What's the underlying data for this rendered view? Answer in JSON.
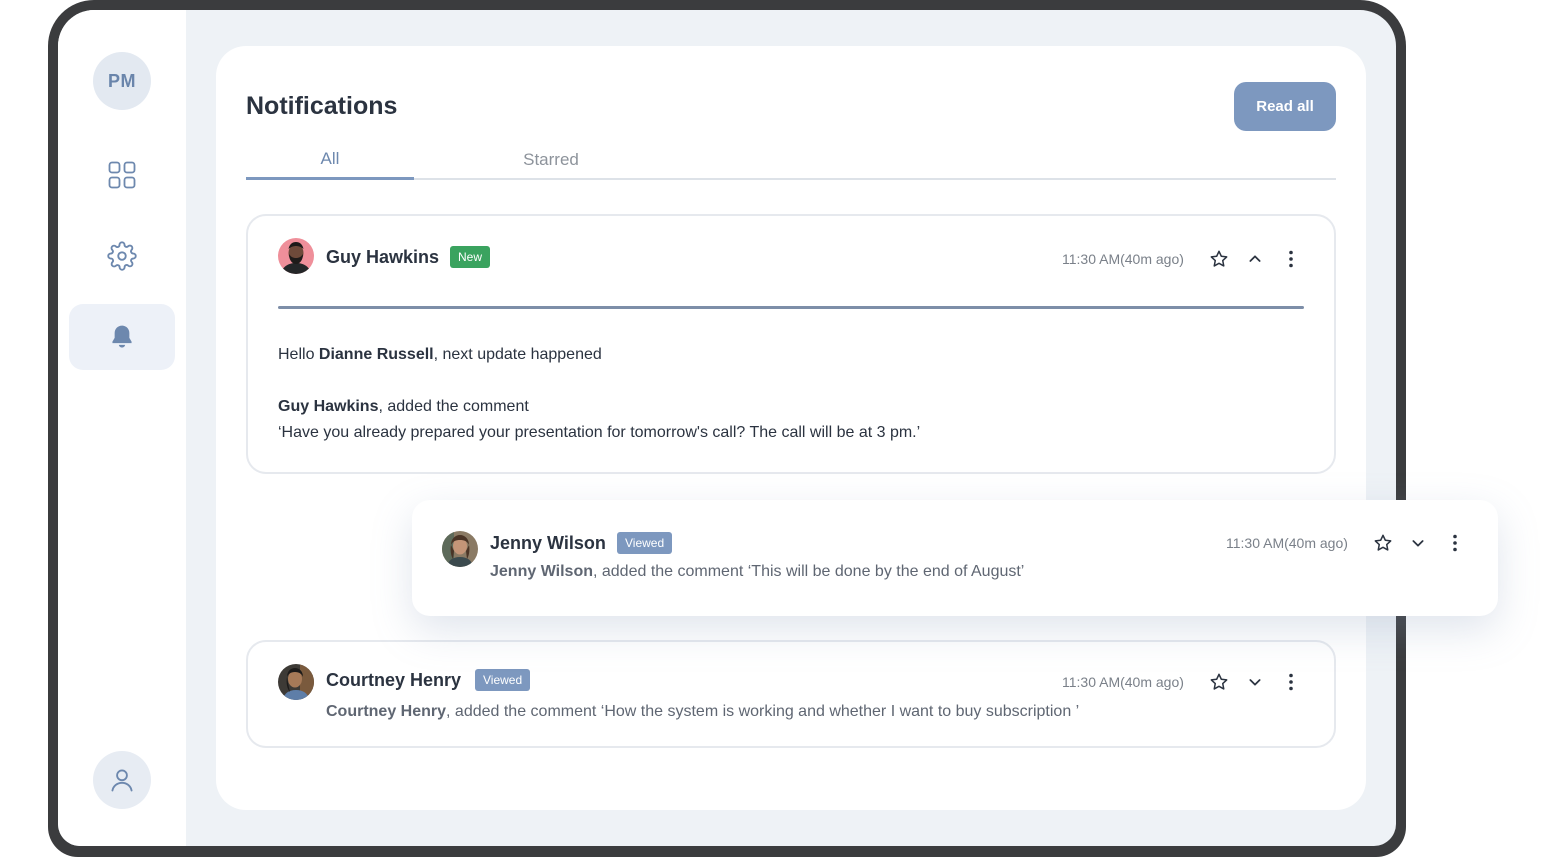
{
  "sidebar": {
    "initials": "PM"
  },
  "header": {
    "title": "Notifications",
    "read_all_label": "Read all"
  },
  "tabs": [
    {
      "label": "All",
      "active": true
    },
    {
      "label": "Starred",
      "active": false
    }
  ],
  "colors": {
    "accent": "#7d98bf",
    "new_badge": "#3aa35f",
    "viewed_badge": "#7d98bf"
  },
  "notifications": [
    {
      "name": "Guy Hawkins",
      "badge": "New",
      "time": "11:30 AM(40m ago)",
      "expanded": true,
      "greeting_prefix": "Hello ",
      "greeting_name": "Dianne Russell",
      "greeting_suffix": ", next update happened",
      "comment_author": "Guy Hawkins",
      "comment_action": ", added the comment",
      "comment_text": " ‘Have you already prepared your presentation for tomorrow's call? The call will be at 3 pm.’"
    },
    {
      "name": "Jenny Wilson",
      "badge": "Viewed",
      "time": "11:30 AM(40m ago)",
      "expanded": false,
      "comment_author": "Jenny Wilson",
      "comment_text": ", added the comment  ‘This will be done by the end of August’"
    },
    {
      "name": "Courtney Henry",
      "badge": "Viewed",
      "time": "11:30 AM(40m ago)",
      "expanded": false,
      "comment_author": "Courtney Henry",
      "comment_text": ", added the comment  ‘How the system is working and whether I want to buy subscription ’"
    }
  ],
  "icons": {
    "dashboard": "grid-icon",
    "settings": "gear-icon",
    "notifications": "bell-icon",
    "profile": "user-icon",
    "star": "star-icon",
    "collapse": "chevron-up-icon",
    "expand": "chevron-down-icon",
    "more": "more-vertical-icon"
  }
}
